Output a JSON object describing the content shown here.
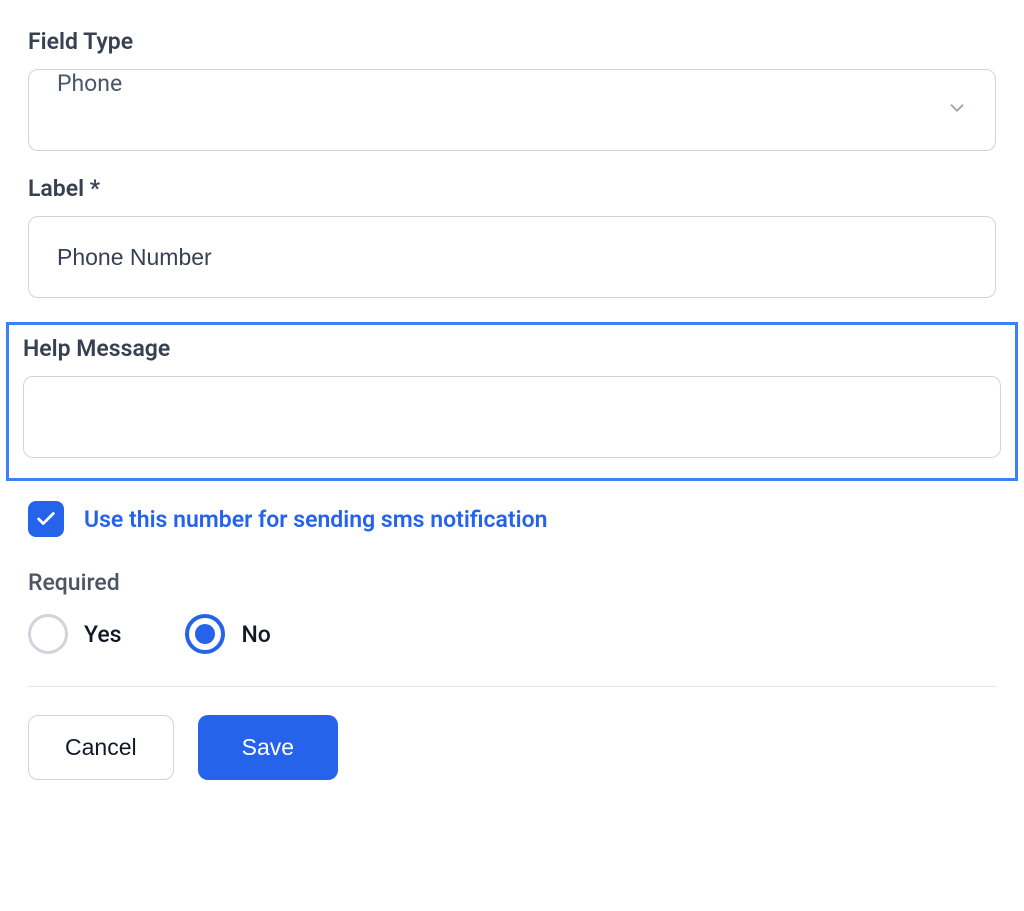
{
  "fieldType": {
    "label": "Field Type",
    "value": "Phone"
  },
  "labelField": {
    "label": "Label *",
    "value": "Phone Number"
  },
  "helpMessage": {
    "label": "Help Message",
    "value": ""
  },
  "smsCheckbox": {
    "label": "Use this number for sending sms notification",
    "checked": true
  },
  "required": {
    "label": "Required",
    "options": {
      "yes": "Yes",
      "no": "No"
    },
    "selected": "no"
  },
  "buttons": {
    "cancel": "Cancel",
    "save": "Save"
  }
}
